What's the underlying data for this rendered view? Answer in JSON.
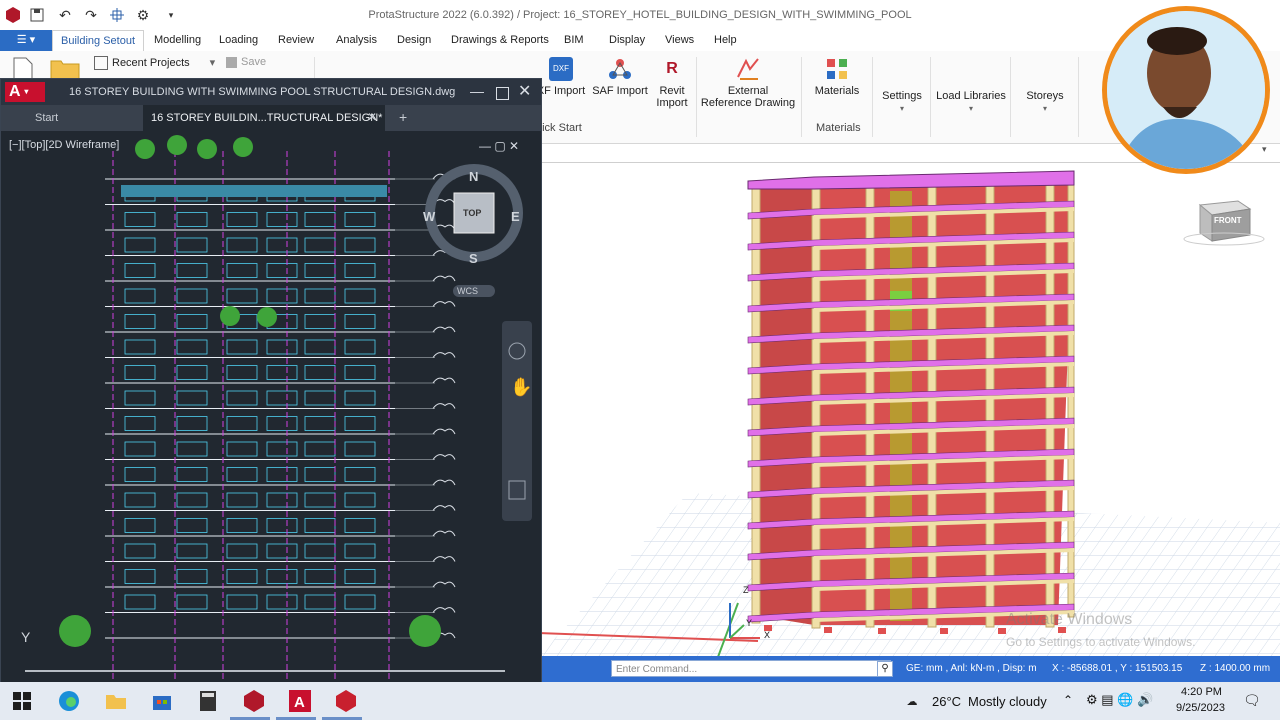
{
  "app": {
    "title": "ProtaStructure 2022 (6.0.392) / Project: 16_STOREY_HOTEL_BUILDING_DESIGN_WITH_SWIMMING_POOL"
  },
  "ribbon_tabs": [
    "Building Setout",
    "Modelling",
    "Loading",
    "Review",
    "Analysis",
    "Design",
    "Drawings & Reports",
    "BIM",
    "Display",
    "Views",
    "Help"
  ],
  "ribbon": {
    "recent_projects": "Recent Projects",
    "save": "Save",
    "dxf_import": "XF Import",
    "saf_import": "SAF Import",
    "revit_import_1": "Revit",
    "revit_import_2": "Import",
    "external_ref_1": "External",
    "external_ref_2": "Reference Drawing",
    "materials": "Materials",
    "settings": "Settings",
    "load_libraries": "Load Libraries",
    "storeys": "Storeys",
    "group_quick_start": "uick Start",
    "group_materials": "Materials"
  },
  "acad": {
    "title": "16 STOREY BUILDING WITH SWIMMING POOL STRUCTURAL DESIGN.dwg",
    "tab_start": "Start",
    "tab_file": "16 STOREY BUILDIN...TRUCTURAL DESIGN*",
    "view_label": "[−][Top][2D Wireframe]",
    "compass": {
      "n": "N",
      "s": "S",
      "e": "E",
      "w": "W",
      "top": "TOP"
    },
    "wcs": "WCS",
    "axis_y": "Y"
  },
  "viewcube": {
    "front": "FRONT"
  },
  "watermark": {
    "line1": "Activate Windows",
    "line2": "Go to Settings to activate Windows."
  },
  "axes3d": {
    "z": "Z",
    "y": "Y",
    "x": "X"
  },
  "statusbar": {
    "command_placeholder": "Enter Command...",
    "units": "GE: mm , Anl: kN-m , Disp: m",
    "coords": "X : -85688.01 , Y : 151503.15",
    "z": "Z : 1400.00 mm"
  },
  "taskbar": {
    "weather_temp": "26°C",
    "weather_desc": "Mostly cloudy",
    "time": "4:20 PM",
    "date": "9/25/2023"
  },
  "colors": {
    "accent": "#2b6cc4",
    "avatar_ring": "#f08a1a",
    "beam": "#e070e8",
    "slab": "#e05050",
    "column": "#f0e0a8"
  }
}
